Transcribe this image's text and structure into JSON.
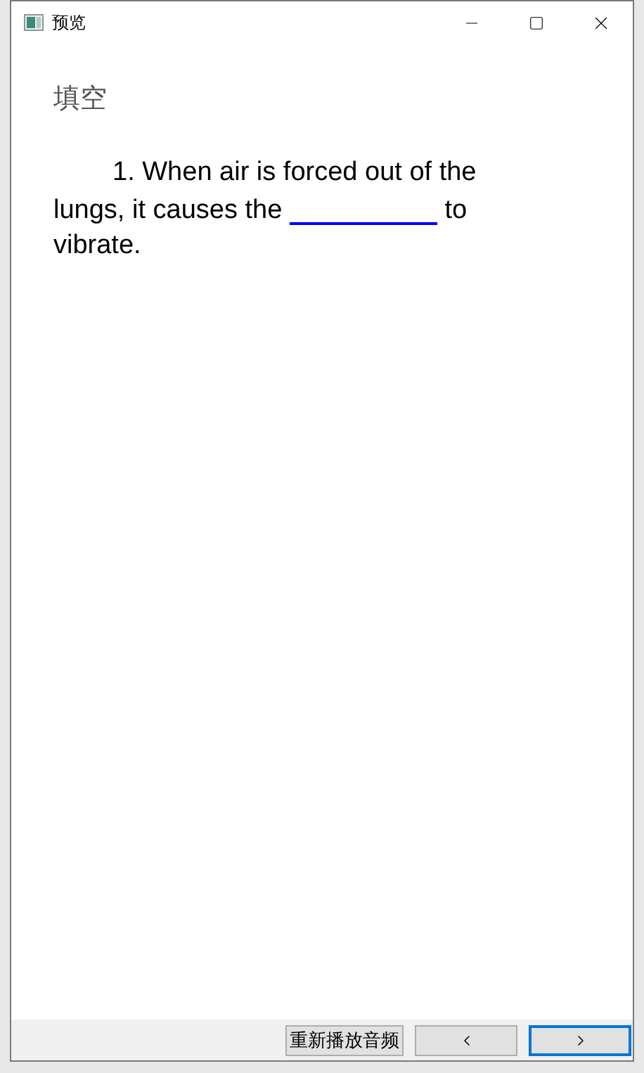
{
  "window": {
    "title": "预览"
  },
  "heading": "填空",
  "question": {
    "before": "1. When air is forced out of the lungs, it causes the",
    "after": "to vibrate."
  },
  "buttons": [
    {
      "kind": "text",
      "label": "重新播放音频",
      "focused": false
    },
    {
      "kind": "prev",
      "focused": false
    },
    {
      "kind": "next",
      "focused": true
    }
  ]
}
